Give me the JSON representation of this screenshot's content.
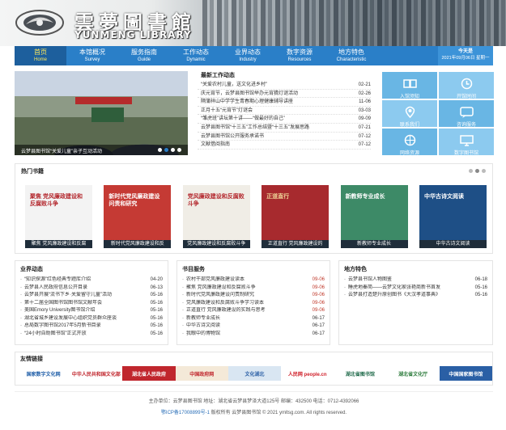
{
  "header": {
    "logo_cn": "雲夢圖書館",
    "logo_en": "YUNMENG LIBRARY"
  },
  "nav": {
    "items": [
      {
        "cn": "首页",
        "en": "Home"
      },
      {
        "cn": "本馆概况",
        "en": "Survey"
      },
      {
        "cn": "服务指南",
        "en": "Guide"
      },
      {
        "cn": "工作动态",
        "en": "Dynamic"
      },
      {
        "cn": "业界动态",
        "en": "Industry"
      },
      {
        "cn": "数字资源",
        "en": "Resources"
      },
      {
        "cn": "地方特色",
        "en": "Characteristic"
      }
    ],
    "today_label": "今天是",
    "today_value": "2021年09月06日 星期一"
  },
  "slider": {
    "caption": "云梦县图书馆“关爱儿童”亲子互动活动"
  },
  "news": {
    "title": "最新工作动态",
    "items": [
      {
        "title": "“关爱农村儿童，送文化进乡村”",
        "date": "02-21"
      },
      {
        "title": "庆元宵节，云梦县图书馆举办元宵猜灯谜活动",
        "date": "02-26"
      },
      {
        "title": "隔蒲祥山中学学生青春期心理健康辅导讲座",
        "date": "11-06"
      },
      {
        "title": "正月十五“元宵节”灯谜会",
        "date": "03-03"
      },
      {
        "title": "“雏虎班”讲坛第十讲——“做最好的自己”",
        "date": "09-09"
      },
      {
        "title": "云梦县图书馆“十三五”工作总结暨“十三五”发展思路",
        "date": "07-21"
      },
      {
        "title": "云梦县图书馆公开服务承诺书",
        "date": "07-12"
      },
      {
        "title": "文献借阅指南",
        "date": "07-12"
      }
    ]
  },
  "tiles": [
    {
      "label": "入馆须知",
      "icon": "book-icon"
    },
    {
      "label": "开馆时间",
      "icon": "clock-icon"
    },
    {
      "label": "联系我们",
      "icon": "location-icon"
    },
    {
      "label": "咨询服务",
      "icon": "chat-icon"
    },
    {
      "label": "网络资源",
      "icon": "network-icon"
    },
    {
      "label": "数字图书馆",
      "icon": "computer-icon"
    }
  ],
  "hot_books": {
    "title": "热门书籍",
    "items": [
      {
        "caption": "聚焦 党风廉政建设和反腐",
        "cover": "聚焦 党风廉政建设和反腐败斗争",
        "bg": "#f3f3f3",
        "fg": "#b3262c"
      },
      {
        "caption": "新时代党风廉政建设和反",
        "cover": "新时代党风廉政建设 问责和研究",
        "bg": "#c53a34",
        "fg": "#fff"
      },
      {
        "caption": "党风廉政建设和反腐败斗争",
        "cover": "党风廉政建设和反腐败斗争",
        "bg": "#f0ede6",
        "fg": "#b3262c"
      },
      {
        "caption": "正道直行 党风廉政建设的",
        "cover": "正道直行",
        "bg": "#a72a2e",
        "fg": "#f0d79a"
      },
      {
        "caption": "新教师专业成长",
        "cover": "新教师专业成长",
        "bg": "#3d8a67",
        "fg": "#fff"
      },
      {
        "caption": "中华古诗文阅读",
        "cover": "中华古诗文阅读",
        "bg": "#1e4f86",
        "fg": "#fff"
      }
    ]
  },
  "industry": {
    "title": "业界动态",
    "items": [
      {
        "title": "“知识探源”红色经典专题库介绍",
        "date": "04-20"
      },
      {
        "title": "云梦县人民政府信息公开目录",
        "date": "06-13"
      },
      {
        "title": "云梦县开展“流书下乡·关爱留守儿童”活动",
        "date": "05-16"
      },
      {
        "title": "第十二届全国图书馆图书馆文献年会",
        "date": "05-16"
      },
      {
        "title": "美国Emory University图书馆介绍",
        "date": "05-16"
      },
      {
        "title": "湖北省城乡建设发展中心组织党员群众座谈",
        "date": "05-16"
      },
      {
        "title": "总局数字图书馆2017年5月新书目录",
        "date": "05-16"
      },
      {
        "title": "“24小时自助图书馆”正式开放",
        "date": "05-16"
      }
    ]
  },
  "services": {
    "title": "书目服务",
    "items": [
      {
        "title": "农村干部党风廉政建设读本",
        "date": "09-06",
        "red": true
      },
      {
        "title": "聚焦 党风廉政建设和反腐败斗争",
        "date": "09-06",
        "red": true
      },
      {
        "title": "新时代党风廉政建设问责制研究",
        "date": "09-06",
        "red": true
      },
      {
        "title": "党风廉政建设和反腐败斗争学习读本",
        "date": "09-06",
        "red": true
      },
      {
        "title": "正道直行 党风廉政建设的实践与思考",
        "date": "09-06",
        "red": true
      },
      {
        "title": "新教师专业成长",
        "date": "06-17",
        "red": false
      },
      {
        "title": "中华古诗文阅读",
        "date": "06-17",
        "red": false
      },
      {
        "title": "我眼中的博物馆",
        "date": "06-17",
        "red": false
      }
    ]
  },
  "local": {
    "title": "地方特色",
    "items": [
      {
        "title": "云梦县书馆人物图鉴",
        "date": "06-18"
      },
      {
        "title": "睡虎地秦简——云梦文化家张艳商新书首发",
        "date": "05-16"
      },
      {
        "title": "云梦县打造楚升原创图书《大汉孝道事典》",
        "date": "05-16"
      }
    ]
  },
  "links": {
    "title": "友情链接",
    "items": [
      {
        "label": "国家数字文化网",
        "color": "#1f5ea8",
        "bg": "#ffffff"
      },
      {
        "label": "中华人民共和国文化部",
        "color": "#c0262d",
        "bg": "#ffffff"
      },
      {
        "label": "湖北省人民政府",
        "color": "#ffffff",
        "bg": "#c0262d"
      },
      {
        "label": "中国政府网",
        "color": "#c0262d",
        "bg": "#f4e9d8"
      },
      {
        "label": "文化湖北",
        "color": "#2a5fa5",
        "bg": "#d9e6f2"
      },
      {
        "label": "人民网 people.cn",
        "color": "#d0202a",
        "bg": "#ffffff"
      },
      {
        "label": "湖北省图书馆",
        "color": "#1f6a4a",
        "bg": "#ffffff"
      },
      {
        "label": "湖北省文化厅",
        "color": "#2a7a3a",
        "bg": "#ffffff"
      },
      {
        "label": "中国国家图书馆",
        "color": "#ffffff",
        "bg": "#2a5fa5"
      }
    ]
  },
  "footer": {
    "line1": "主办单位：云梦县图书馆  地址：湖北省云梦县梦泽大道125号  邮编：432500  电话：0712-4392066",
    "icp": "鄂ICP备17008899号-1",
    "line2_rest": "  版权所有 云梦县图书馆 © 2021 ymltsg.com. All rights reserved."
  },
  "colors": {
    "nav": "#2a7fc8",
    "nav_active": "#1d5f9d",
    "tile": "#69b6e4"
  }
}
